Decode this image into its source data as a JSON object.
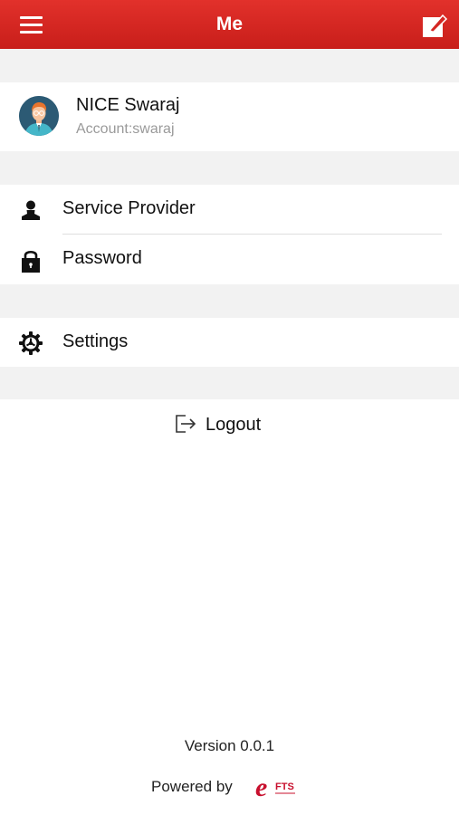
{
  "header": {
    "title": "Me",
    "menu_icon": "hamburger-menu-icon",
    "edit_icon": "edit-icon",
    "color": "#d42723"
  },
  "profile": {
    "name": "NICE Swaraj",
    "account": "Account:swaraj",
    "avatar_icon": "avatar-icon"
  },
  "menu": {
    "service_provider": {
      "label": "Service Provider",
      "icon": "person-icon"
    },
    "password": {
      "label": "Password",
      "icon": "lock-icon"
    },
    "settings": {
      "label": "Settings",
      "icon": "gear-icon"
    }
  },
  "logout": {
    "label": "Logout",
    "icon": "logout-icon"
  },
  "footer": {
    "version": "Version 0.0.1",
    "powered_by": "Powered by",
    "logo_text": "FTS",
    "logo_letter": "e",
    "logo_color": "#c8102e"
  }
}
